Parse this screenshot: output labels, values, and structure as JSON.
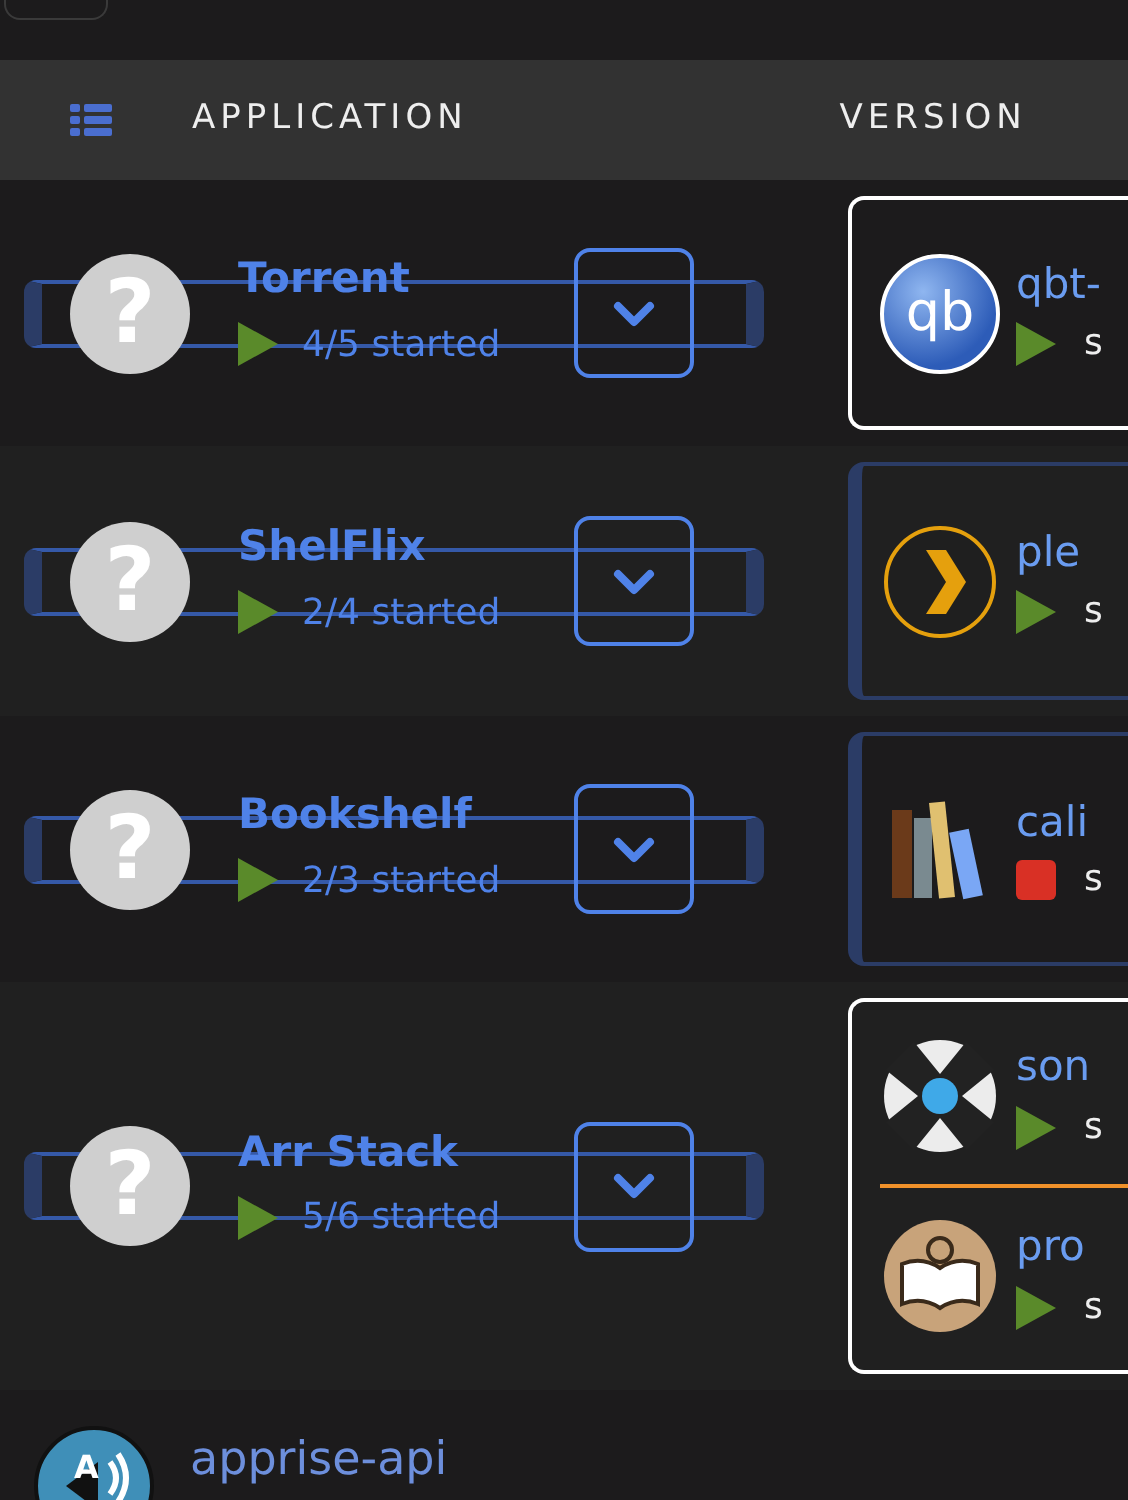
{
  "header": {
    "columns": [
      "APPLICATION",
      "VERSION"
    ]
  },
  "groups": [
    {
      "name": "Torrent",
      "icon": "?",
      "status": "4/5 started",
      "running": true,
      "card_highlighted": true,
      "containers": [
        {
          "name": "qbt-",
          "kind": "qb",
          "logo_text": "qb",
          "running": true,
          "status": "s"
        }
      ]
    },
    {
      "name": "ShelFlix",
      "icon": "?",
      "status": "2/4 started",
      "running": true,
      "card_highlighted": false,
      "containers": [
        {
          "name": "ple",
          "kind": "plex",
          "running": true,
          "status": "s"
        }
      ]
    },
    {
      "name": "Bookshelf",
      "icon": "?",
      "status": "2/3 started",
      "running": true,
      "card_highlighted": false,
      "containers": [
        {
          "name": "cali",
          "kind": "calibre",
          "running": false,
          "status": "s"
        }
      ]
    },
    {
      "name": "Arr Stack",
      "icon": "?",
      "status": "5/6 started",
      "running": true,
      "card_highlighted": true,
      "containers": [
        {
          "name": "son",
          "kind": "sonarr",
          "running": true,
          "status": "s"
        },
        {
          "name": "pro",
          "kind": "prowlarr",
          "running": true,
          "status": "s"
        }
      ]
    }
  ],
  "standalone": [
    {
      "name": "apprise-api",
      "kind": "apprise",
      "logo_text": "A"
    }
  ]
}
